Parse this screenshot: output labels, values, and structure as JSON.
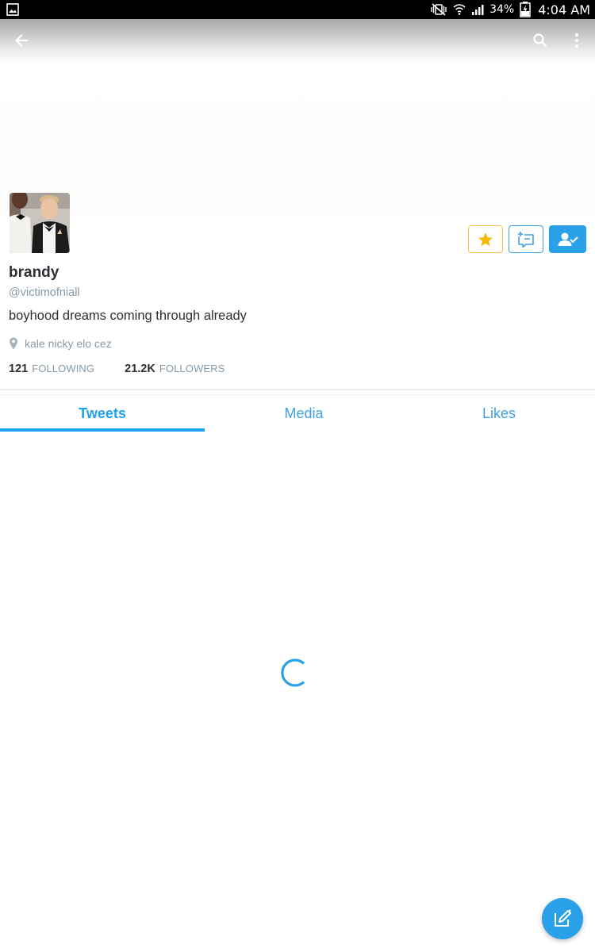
{
  "status_bar": {
    "battery": "34%",
    "time": "4:04 AM",
    "icons": [
      "gallery-icon",
      "mute-vibrate-icon",
      "wifi-icon",
      "signal-icon",
      "battery-charging-icon"
    ]
  },
  "app_bar": {
    "icons": [
      "back-arrow-icon",
      "search-icon",
      "more-vert-icon"
    ]
  },
  "profile": {
    "name": "brandy",
    "handle": "@victimofniall",
    "bio": "boyhood dreams coming through already",
    "location": "kale nicky elo cez",
    "following_count": "121",
    "following_label": "FOLLOWING",
    "followers_count": "21.2K",
    "followers_label": "FOLLOWERS"
  },
  "actions": {
    "icons": [
      "star-icon",
      "add-to-list-icon",
      "following-check-icon"
    ]
  },
  "tabs": [
    {
      "label": "Tweets",
      "active": true
    },
    {
      "label": "Media",
      "active": false
    },
    {
      "label": "Likes",
      "active": false
    }
  ],
  "colors": {
    "accent": "#1da1f2",
    "star": "#f5b800",
    "text_primary": "#292f33",
    "text_secondary": "#8899a6"
  },
  "fab": {
    "icon": "compose-tweet-icon"
  }
}
